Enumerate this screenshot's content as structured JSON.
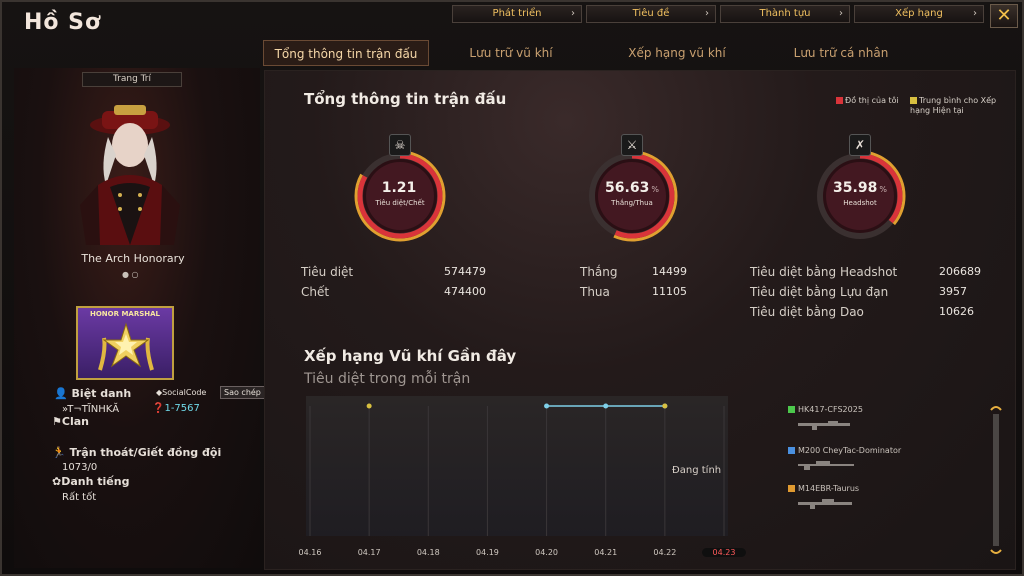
{
  "window": {
    "title": "Hồ Sơ",
    "close_icon": "close-x-icon"
  },
  "top_nav": [
    {
      "label": "Phát triển"
    },
    {
      "label": "Tiêu đề"
    },
    {
      "label": "Thành tựu"
    },
    {
      "label": "Xếp hạng"
    }
  ],
  "tabs": [
    {
      "label": "Tổng thông tin trận đấu",
      "active": true
    },
    {
      "label": "Lưu trữ vũ khí",
      "active": false
    },
    {
      "label": "Xếp hạng vũ khí",
      "active": false
    },
    {
      "label": "Lưu trữ cá nhân",
      "active": false
    }
  ],
  "profile": {
    "decor_label": "Trang Trí",
    "skin_name": "The Arch Honorary",
    "carousel_dots": "● ○",
    "rank_badge_text": "HONOR MARSHAL",
    "nickname_label": "Biệt danh",
    "nickname_value": "»T¬TĨNHKĂ",
    "social_code_label": "SocialCode",
    "copy_button": "Sao chép",
    "social_code_value": "1-7567",
    "clan_label": "Clan",
    "escape_label": "Trận thoát/Giết đồng đội",
    "escape_value": "1073/0",
    "reputation_label": "Danh tiếng",
    "reputation_value": "Rất tốt"
  },
  "overview": {
    "title": "Tổng thông tin trận đấu",
    "legend": [
      {
        "label": "Đồ thị của tôi",
        "color": "#d9343a"
      },
      {
        "label": "Trung bình cho Xếp hạng Hiện tại",
        "color": "#d8c040"
      }
    ],
    "gauges": [
      {
        "value": "1.21",
        "suffix": "",
        "label": "Tiêu diệt/Chết",
        "fill": 0.83,
        "icon": "skull-icon"
      },
      {
        "value": "56.63",
        "suffix": "%",
        "label": "Thắng/Thua",
        "fill": 0.5663,
        "icon": "crossed-swords-icon"
      },
      {
        "value": "35.98",
        "suffix": "%",
        "label": "Headshot",
        "fill": 0.3598,
        "icon": "crossed-guns-icon"
      }
    ],
    "stats": {
      "kills_label": "Tiêu diệt",
      "kills_value": "574479",
      "deaths_label": "Chết",
      "deaths_value": "474400",
      "wins_label": "Thắng",
      "wins_value": "14499",
      "losses_label": "Thua",
      "losses_value": "11105",
      "headshot_kills_label": "Tiêu diệt bằng Headshot",
      "headshot_kills_value": "206689",
      "grenade_kills_label": "Tiêu diệt bằng Lựu đạn",
      "grenade_kills_value": "3957",
      "knife_kills_label": "Tiêu diệt bằng Dao",
      "knife_kills_value": "10626"
    }
  },
  "weapon_rank": {
    "title": "Xếp hạng Vũ khí Gần đây",
    "subtitle": "Tiêu diệt trong mỗi trận",
    "status_text": "Đang tính",
    "weapons": [
      {
        "name": "HK417-CFS2025",
        "color": "#4cc84c"
      },
      {
        "name": "M200 CheyTac-Dominator",
        "color": "#4a90e0"
      },
      {
        "name": "M14EBR-Taurus",
        "color": "#e09a30"
      }
    ]
  },
  "chart_data": {
    "type": "line",
    "title": "Xếp hạng Vũ khí Gần đây",
    "subtitle": "Tiêu diệt trong mỗi trận",
    "x": [
      "04.16",
      "04.17",
      "04.18",
      "04.19",
      "04.20",
      "04.21",
      "04.22",
      "04.23"
    ],
    "current_x": "04.23",
    "series": [
      {
        "color": "#7fd0e8",
        "values": [
          null,
          null,
          null,
          null,
          1,
          1,
          1,
          null
        ]
      },
      {
        "color": "#d8c040",
        "values": [
          null,
          1,
          null,
          null,
          null,
          null,
          1,
          null
        ]
      }
    ],
    "ylim": [
      0,
      1
    ]
  }
}
